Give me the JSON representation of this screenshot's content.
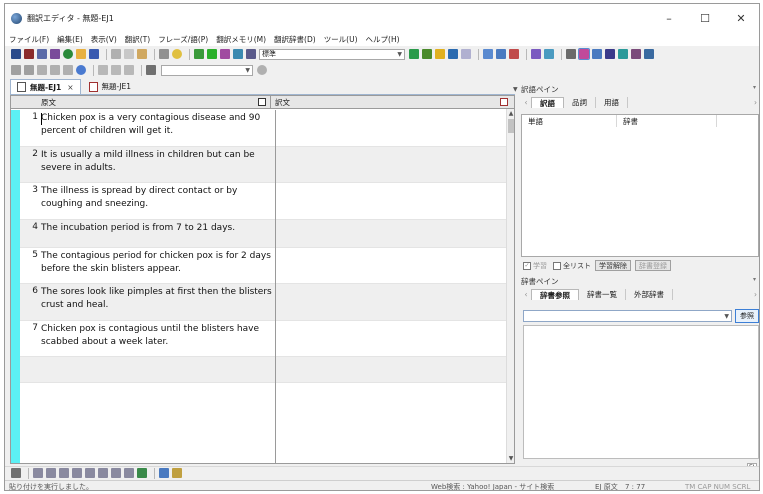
{
  "window": {
    "title": "翻訳エディタ - 無題-EJ1",
    "minimize": "–",
    "maximize": "☐",
    "close": "✕"
  },
  "menu": [
    "ファイル(F)",
    "編集(E)",
    "表示(V)",
    "翻訳(T)",
    "フレーズ/語(P)",
    "翻訳メモリ(M)",
    "翻訳辞書(D)",
    "ツール(U)",
    "ヘルプ(H)"
  ],
  "toolbar": {
    "style_combo": "標準"
  },
  "editor": {
    "tabs": [
      {
        "label": "無題-EJ1",
        "close": "×",
        "active": true
      },
      {
        "label": "無題-JE1",
        "active": false
      }
    ],
    "header_source": "原文",
    "header_target": "訳文",
    "rows": [
      {
        "num": "1",
        "source": "Chicken pox is a very contagious disease and 90 percent of children will get it.",
        "target": ""
      },
      {
        "num": "2",
        "source": "It is usually a mild illness in children but can be severe in adults.",
        "target": ""
      },
      {
        "num": "3",
        "source": "The illness is spread by direct contact or by coughing and sneezing.",
        "target": ""
      },
      {
        "num": "4",
        "source": "The incubation period is from 7 to 21 days.",
        "target": ""
      },
      {
        "num": "5",
        "source": "The contagious period for chicken pox is for 2 days before the skin blisters appear.",
        "target": ""
      },
      {
        "num": "6",
        "source": "The sores look like pimples at first then the blisters crust and heal.",
        "target": ""
      },
      {
        "num": "7",
        "source": "Chicken pox is contagious until the blisters have scabbed about a week later.",
        "target": ""
      }
    ]
  },
  "translation_pane": {
    "title": "訳語ペイン",
    "tabs": [
      "訳語",
      "品詞",
      "用語"
    ],
    "col_word": "単語",
    "col_dict": "辞書",
    "learn_label": "学習",
    "all_list_label": "全リスト",
    "unlearn_button": "学習解除",
    "register_button": "辞書登録"
  },
  "dictionary_pane": {
    "title": "辞書ペイン",
    "tabs": [
      "辞書参照",
      "辞書一覧",
      "外部辞書"
    ],
    "ref_button": "参照",
    "lang_label": "EJ"
  },
  "status": {
    "message": "貼り付けを実行しました。",
    "web_search": "Web検索 : Yahoo! Japan - サイト検索",
    "mode": "EJ 原文",
    "position": "7 : 77",
    "keys": "TM CAP NUM SCRL"
  },
  "colors": {
    "row_marker": "#5cf0f4",
    "accent": "#3c7fd6"
  }
}
